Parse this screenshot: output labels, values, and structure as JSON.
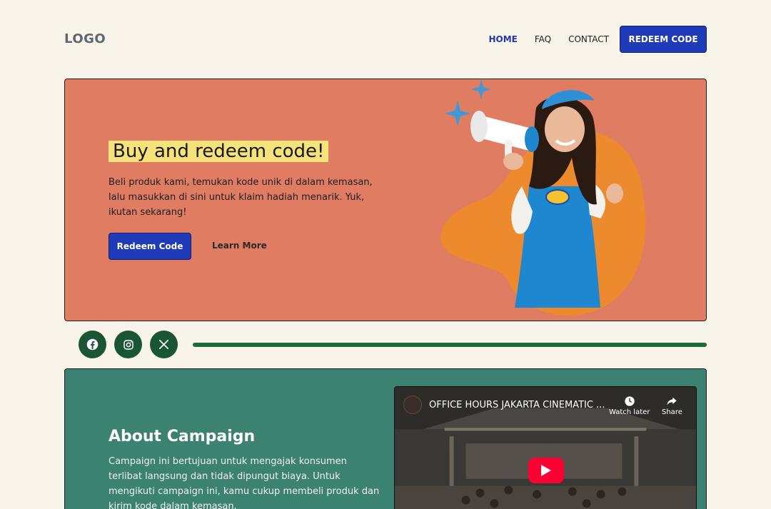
{
  "header": {
    "logo": "LOGO",
    "nav": [
      {
        "label": "HOME",
        "active": true
      },
      {
        "label": "FAQ",
        "active": false
      },
      {
        "label": "CONTACT",
        "active": false
      }
    ],
    "cta_label": "REDEEM CODE"
  },
  "hero": {
    "title": "Buy and redeem code!",
    "description": "Beli produk kami, temukan kode unik di dalam kemasan, lalu masukkan di sini untuk klaim hadiah menarik. Yuk, ikutan sekarang!",
    "primary_button": "Redeem Code",
    "secondary_link": "Learn More",
    "colors": {
      "background": "#e07c62",
      "highlight": "#f6e27a",
      "blob": "#ee8a2e",
      "sparkle": "#3d9ad6"
    }
  },
  "social": {
    "icons": [
      "facebook-icon",
      "instagram-icon",
      "x-icon"
    ],
    "color": "#1a5535"
  },
  "about": {
    "title": "About Campaign",
    "description": "Campaign ini bertujuan untuk mengajak konsumen terlibat langsung dan tidak dipungut biaya. Untuk mengikuti campaign ini, kamu cukup membeli produk dan kirim kode dalam kemasan.",
    "video": {
      "title": "OFFICE HOURS JAKARTA CINEMATIC ...",
      "watch_later": "Watch later",
      "share": "Share"
    },
    "colors": {
      "background": "#3b8270",
      "play": "#ff0033"
    }
  }
}
